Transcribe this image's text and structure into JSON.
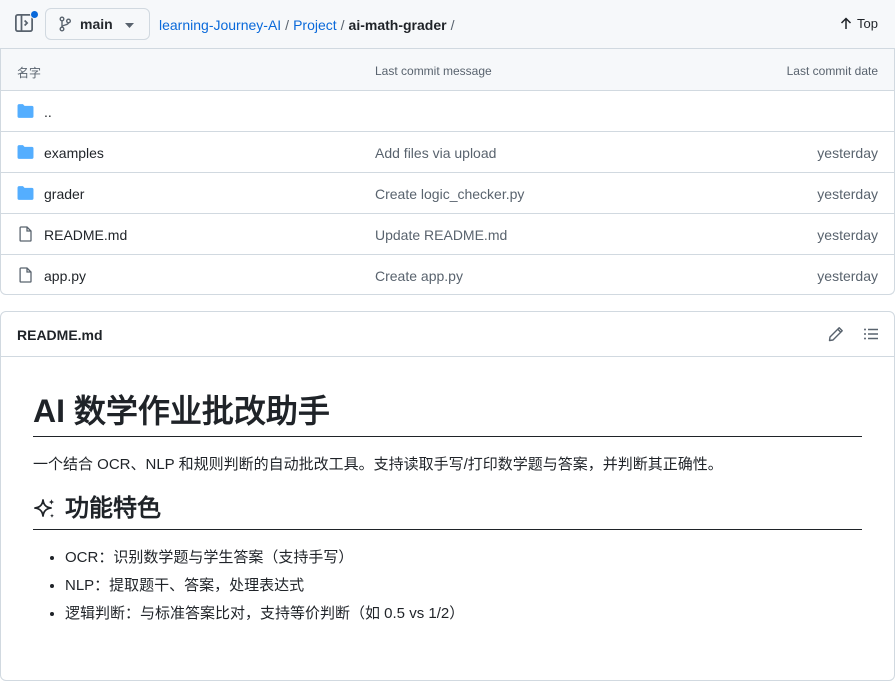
{
  "colors": {
    "link": "#0969da",
    "folder": "#54aeff",
    "border": "#d1d9e0"
  },
  "topbar": {
    "branch": "main",
    "breadcrumb": {
      "repo": "learning-Journey-AI",
      "folder": "Project",
      "current": "ai-math-grader",
      "separator": "/"
    },
    "top_label": "Top"
  },
  "file_table": {
    "columns": {
      "name": "名字",
      "message": "Last commit message",
      "date": "Last commit date"
    },
    "rows": [
      {
        "name": "..",
        "icon": "folder-icon",
        "message": "",
        "date": ""
      },
      {
        "name": "examples",
        "icon": "folder-icon",
        "message": "Add files via upload",
        "date": "yesterday"
      },
      {
        "name": "grader",
        "icon": "folder-icon",
        "message": "Create logic_checker.py",
        "date": "yesterday"
      },
      {
        "name": "README.md",
        "icon": "file-icon",
        "message": "Update README.md",
        "date": "yesterday"
      },
      {
        "name": "app.py",
        "icon": "file-icon",
        "message": "Create app.py",
        "date": "yesterday"
      }
    ]
  },
  "readme": {
    "file_name": "README.md",
    "h1": "AI 数学作业批改助手",
    "description": "一个结合 OCR、NLP 和规则判断的自动批改工具。支持读取手写/打印数学题与答案，并判断其正确性。",
    "features_heading": "功能特色",
    "features": [
      "OCR：识别数学题与学生答案（支持手写）",
      "NLP：提取题干、答案，处理表达式",
      "逻辑判断：与标准答案比对，支持等价判断（如 0.5 vs 1/2）"
    ]
  }
}
